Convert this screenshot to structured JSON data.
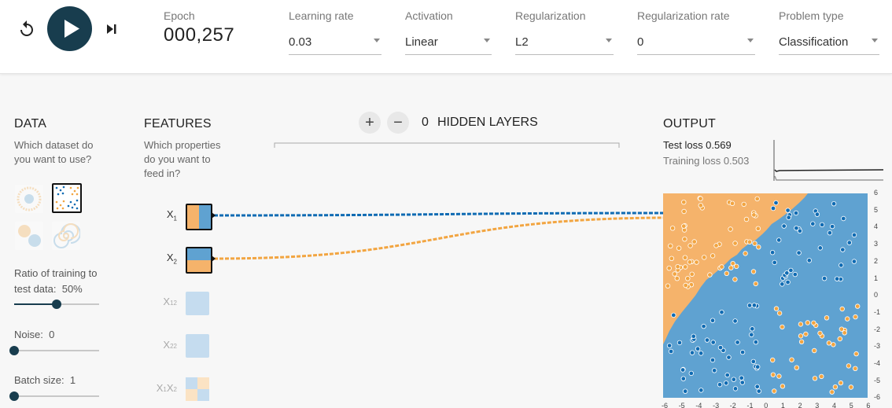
{
  "controls": {
    "epoch_label": "Epoch",
    "epoch_value": "000,257",
    "learning_rate": {
      "label": "Learning rate",
      "value": "0.03"
    },
    "activation": {
      "label": "Activation",
      "value": "Linear"
    },
    "regularization": {
      "label": "Regularization",
      "value": "L2"
    },
    "regularization_rate": {
      "label": "Regularization rate",
      "value": "0"
    },
    "problem_type": {
      "label": "Problem type",
      "value": "Classification"
    }
  },
  "data_panel": {
    "title": "DATA",
    "desc_line1": "Which dataset do",
    "desc_line2": "you want to use?",
    "datasets": [
      "circle",
      "xor",
      "gaussian",
      "spiral"
    ],
    "selected_dataset": "xor",
    "ratio": {
      "label_line1": "Ratio of training to",
      "label_line2": "test data:",
      "value": "50%",
      "fraction": 0.5
    },
    "noise": {
      "label": "Noise:",
      "value": "0",
      "fraction": 0
    },
    "batch": {
      "label": "Batch size:",
      "value": "1",
      "fraction": 0
    }
  },
  "features_panel": {
    "title": "FEATURES",
    "desc_line1": "Which properties",
    "desc_line2": "do you want to",
    "desc_line3": "feed in?",
    "features": [
      {
        "base": "X",
        "sub": "1",
        "sup": "",
        "active": true
      },
      {
        "base": "X",
        "sub": "2",
        "sup": "",
        "active": true
      },
      {
        "base": "X",
        "sub": "1",
        "sup": "2",
        "active": false
      },
      {
        "base": "X",
        "sub": "2",
        "sup": "2",
        "active": false
      },
      {
        "base": "X",
        "sub": "1",
        "sup": "",
        "base2": "X",
        "sub2": "2",
        "active": false
      }
    ]
  },
  "network": {
    "add_label": "+",
    "remove_label": "−",
    "layer_count": "0",
    "layers_label": "HIDDEN LAYERS"
  },
  "output_panel": {
    "title": "OUTPUT",
    "test_loss": "Test loss 0.569",
    "training_loss": "Training loss 0.503",
    "y_ticks": [
      "6",
      "5",
      "4",
      "3",
      "2",
      "1",
      "0",
      "-1",
      "-2",
      "-3",
      "-4",
      "-5",
      "-6"
    ],
    "x_ticks": [
      "-6",
      "-5",
      "-4",
      "-3",
      "-2",
      "-1",
      "0",
      "1",
      "2",
      "3",
      "4",
      "5",
      "6"
    ]
  },
  "colors": {
    "orange": "#f5b36b",
    "blue": "#5fa2d1",
    "point_orange": "#f2a541",
    "point_blue": "#0f6bb3",
    "dark": "#183d4e"
  }
}
